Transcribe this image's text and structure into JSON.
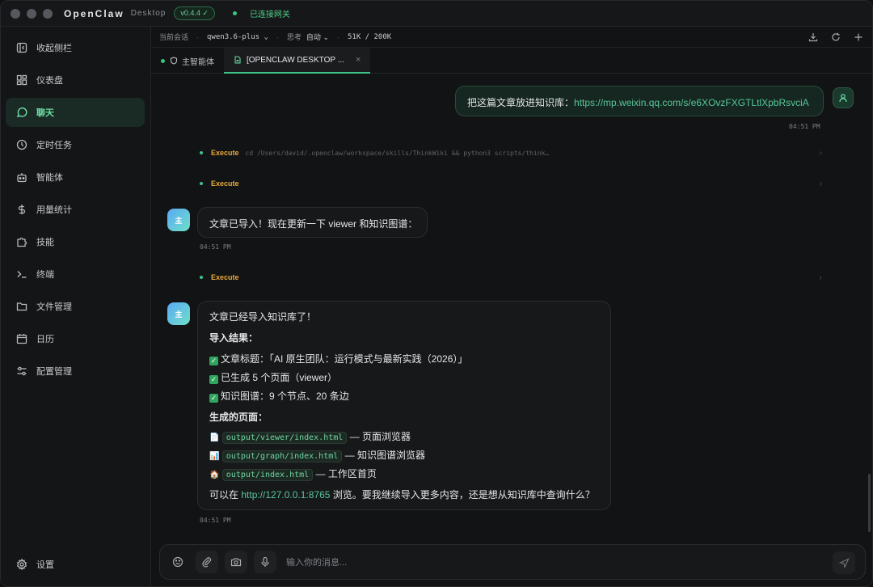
{
  "titlebar": {
    "app_name": "OpenClaw",
    "app_sub": "Desktop",
    "version": "v0.4.4 ✓",
    "gateway_status": "已连接网关"
  },
  "sidebar": {
    "collapse": "收起侧栏",
    "items": [
      {
        "label": "仪表盘",
        "icon": "dashboard-icon"
      },
      {
        "label": "聊天",
        "icon": "chat-icon"
      },
      {
        "label": "定时任务",
        "icon": "clock-icon"
      },
      {
        "label": "智能体",
        "icon": "robot-icon"
      },
      {
        "label": "用量统计",
        "icon": "dollar-icon"
      },
      {
        "label": "技能",
        "icon": "puzzle-icon"
      },
      {
        "label": "终端",
        "icon": "terminal-icon"
      },
      {
        "label": "文件管理",
        "icon": "folder-icon"
      },
      {
        "label": "日历",
        "icon": "calendar-icon"
      },
      {
        "label": "配置管理",
        "icon": "sliders-icon"
      }
    ],
    "settings": "设置"
  },
  "infobar": {
    "session_label": "当前会话",
    "model": "qwen3.6-plus",
    "think_label": "思考",
    "think_value": "自动",
    "tokens": "51K / 200K"
  },
  "tabs": [
    {
      "label": "主智能体"
    },
    {
      "label": "[OPENCLAW DESKTOP ..."
    }
  ],
  "chat": {
    "user_msg_prefix": "把这篇文章放进知识库：",
    "user_msg_link": "https://mp.weixin.qq.com/s/e6XOvzFXGTLtlXpbRsvciA",
    "user_time": "04:51 PM",
    "exec1_label": "Execute",
    "exec1_cmd": "cd /Users/david/.openclaw/workspace/skills/ThinkWiki && python3 scripts/think…",
    "exec2_label": "Execute",
    "avatar_label": "主",
    "msg1": "文章已导入！现在更新一下 viewer 和知识图谱：",
    "msg1_time": "04:51 PM",
    "exec3_label": "Execute",
    "msg2": {
      "line1": "文章已经导入知识库了！",
      "heading1": "导入结果：",
      "check1": "文章标题：「AI 原生团队：运行模式与最新实践（2026）」",
      "check2": "已生成 5 个页面（viewer）",
      "check3": "知识图谱：9 个节点、20 条边",
      "heading2": "生成的页面：",
      "page1_icon": "📄",
      "page1_code": "output/viewer/index.html",
      "page1_desc": "— 页面浏览器",
      "page2_icon": "📊",
      "page2_code": "output/graph/index.html",
      "page2_desc": "— 知识图谱浏览器",
      "page3_icon": "🏠",
      "page3_code": "output/index.html",
      "page3_desc": "— 工作区首页",
      "footer_prefix": "可以在",
      "footer_link": "http://127.0.0.1:8765",
      "footer_suffix": "浏览。要我继续导入更多内容，还是想从知识库中查询什么？"
    },
    "msg2_time": "04:51 PM"
  },
  "input": {
    "placeholder": "输入你的消息..."
  }
}
